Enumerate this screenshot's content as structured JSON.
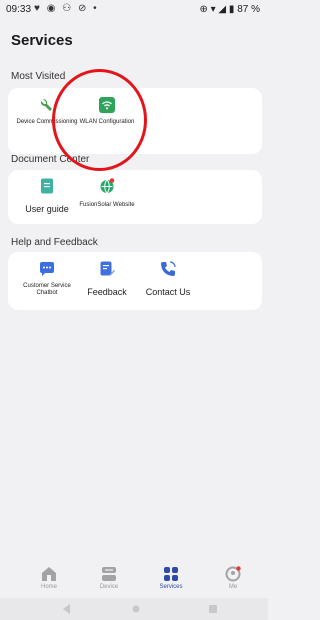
{
  "status": {
    "time": "09:33",
    "battery": "87 %",
    "left_icons": "♥ ◉ ⚇ ⊘ •",
    "right_icons": "⊕ ▾ ◢"
  },
  "page": {
    "title": "Services"
  },
  "sections": [
    {
      "title": "Most Visited",
      "items": [
        {
          "label": "Device Commissioning",
          "icon": "wrench-icon",
          "color": "#43a047"
        },
        {
          "label": "WLAN Configuration",
          "icon": "wifi-icon",
          "color": "#2fa35a"
        }
      ]
    },
    {
      "title": "Document Center",
      "items": [
        {
          "label": "User guide",
          "icon": "document-icon",
          "color": "#3fb1a0"
        },
        {
          "label": "FusionSolar Website",
          "icon": "globe-icon",
          "color": "#26a66b"
        }
      ]
    },
    {
      "title": "Help and Feedback",
      "items": [
        {
          "label": "Customer Service Chatbot",
          "icon": "chat-icon",
          "color": "#3d6ee0"
        },
        {
          "label": "Feedback",
          "icon": "feedback-icon",
          "color": "#4070dd"
        },
        {
          "label": "Contact Us",
          "icon": "phone-icon",
          "color": "#3b6ad6"
        }
      ]
    }
  ],
  "bottom_nav": [
    {
      "label": "Home",
      "icon": "home-icon",
      "active": false
    },
    {
      "label": "Device",
      "icon": "device-icon",
      "active": false
    },
    {
      "label": "Services",
      "icon": "services-icon",
      "active": true
    },
    {
      "label": "Me",
      "icon": "user-icon",
      "active": false
    }
  ],
  "colors": {
    "accent": "#2f4aa8",
    "annotation": "#e3151b",
    "background": "#f1f1f3"
  }
}
